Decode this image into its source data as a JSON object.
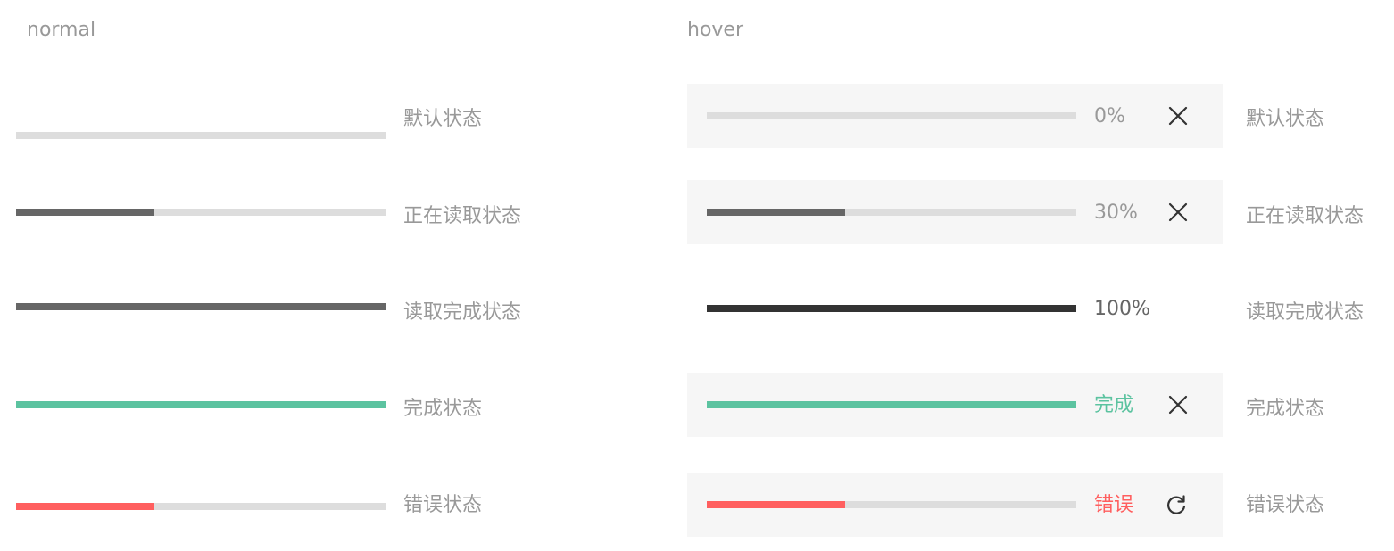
{
  "normal": {
    "title": "normal",
    "rows": [
      {
        "label": "默认状态",
        "progress": 0,
        "fill_color": "#666666"
      },
      {
        "label": "正在读取状态",
        "progress": 0.375,
        "fill_color": "#666666"
      },
      {
        "label": "读取完成状态",
        "progress": 1,
        "fill_color": "#666666"
      },
      {
        "label": "完成状态",
        "progress": 1,
        "fill_color": "#5cc3a0"
      },
      {
        "label": "错误状态",
        "progress": 0.375,
        "fill_color": "#ff5f5f"
      }
    ]
  },
  "hover": {
    "title": "hover",
    "rows": [
      {
        "label": "默认状态",
        "value_text": "0%",
        "value_color": "#999999",
        "progress": 0,
        "fill_color": "#666666",
        "icon": "close-icon"
      },
      {
        "label": "正在读取状态",
        "value_text": "30%",
        "value_color": "#999999",
        "progress": 0.375,
        "fill_color": "#666666",
        "icon": "close-icon"
      },
      {
        "label": "读取完成状态",
        "value_text": "100%",
        "value_color": "#666666",
        "progress": 1,
        "fill_color": "#333333"
      },
      {
        "label": "完成状态",
        "value_text": "完成",
        "value_color": "#5cc3a0",
        "progress": 1,
        "fill_color": "#5cc3a0",
        "icon": "close-icon"
      },
      {
        "label": "错误状态",
        "value_text": "错误",
        "value_color": "#ff5f5f",
        "progress": 0.375,
        "fill_color": "#ff5f5f",
        "icon": "retry-icon"
      }
    ]
  }
}
